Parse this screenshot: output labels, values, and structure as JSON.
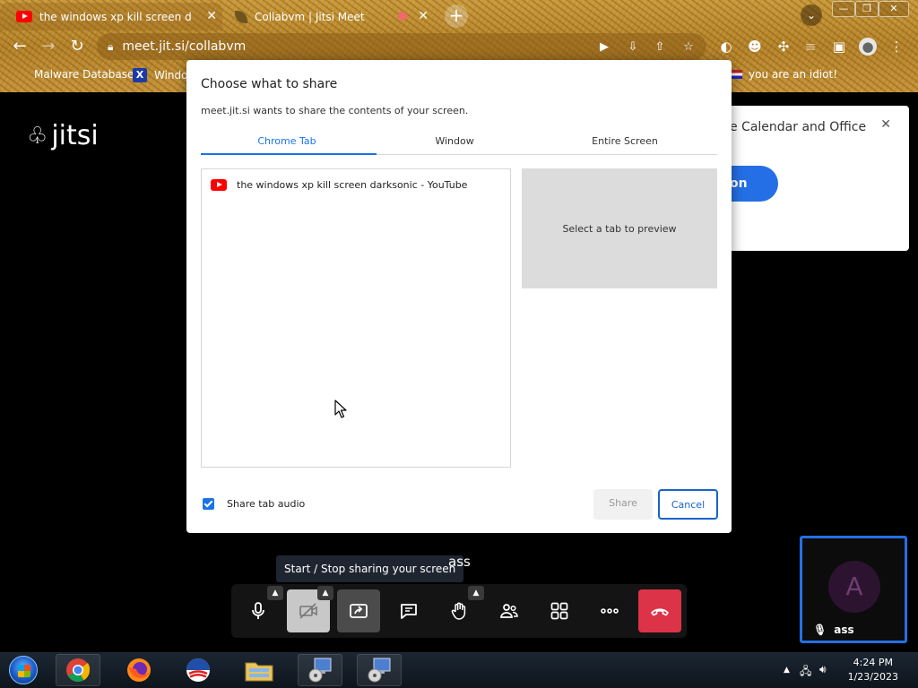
{
  "browser": {
    "tabs": [
      {
        "title": "the windows xp kill screen darksonic",
        "close": "✕"
      },
      {
        "title": "Collabvm | Jitsi Meet",
        "close": "✕"
      }
    ],
    "new_tab": "+",
    "window_controls": {
      "minimize": "—",
      "restore": "❐",
      "close": "✕"
    },
    "url": "meet.jit.si/collabvm",
    "bookmarks": [
      {
        "label": "Malware Database"
      },
      {
        "label": "Windo",
        "icon_text": "X"
      },
      {
        "label": "you are an idiot!"
      }
    ]
  },
  "jitsi": {
    "logo_text": "jitsi",
    "promo_text": "e Calendar and Office",
    "promo_button": "on",
    "tooltip": "Start / Stop sharing your screen",
    "local_name": "ass",
    "thumbnail": {
      "avatar_letter": "A",
      "name": "ass"
    },
    "toolbar_buttons": [
      "microphone",
      "camera",
      "screenshare",
      "chat",
      "raise-hand",
      "participants",
      "tile-view",
      "more",
      "hangup"
    ],
    "colors": {
      "accent": "#246fe5",
      "hangup": "#dd3348"
    }
  },
  "dialog": {
    "title": "Choose what to share",
    "subtitle": "meet.jit.si wants to share the contents of your screen.",
    "tabs": [
      "Chrome Tab",
      "Window",
      "Entire Screen"
    ],
    "active_tab": "Chrome Tab",
    "tab_items": [
      {
        "title": "the windows xp kill screen darksonic - YouTube"
      }
    ],
    "preview_text": "Select a tab to preview",
    "share_audio_label": "Share tab audio",
    "share_audio_checked": true,
    "share_button": "Share",
    "cancel_button": "Cancel"
  },
  "taskbar": {
    "time": "4:24 PM",
    "date": "1/23/2023"
  }
}
